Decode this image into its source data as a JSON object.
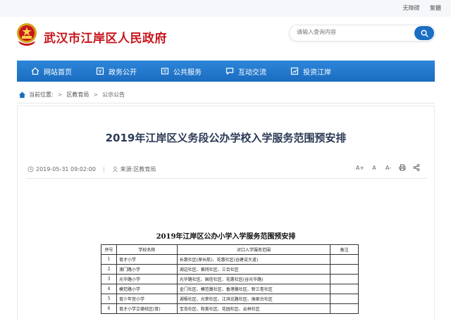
{
  "topbar": {
    "accessibility": "无障碍",
    "traditional": "繁體"
  },
  "header": {
    "site_title": "武汉市江岸区人民政府"
  },
  "search": {
    "placeholder": "请输入查询内容"
  },
  "nav": [
    {
      "label": "网站首页",
      "icon": "home-icon"
    },
    {
      "label": "政务公开",
      "icon": "document-icon"
    },
    {
      "label": "公共服务",
      "icon": "service-icon"
    },
    {
      "label": "互动交流",
      "icon": "chat-icon"
    },
    {
      "label": "投资江岸",
      "icon": "invest-icon"
    }
  ],
  "breadcrumb": {
    "prefix": "当前位置:",
    "items": [
      "区教育局",
      "公示公告"
    ],
    "separator": ">"
  },
  "article": {
    "title": "2019年江岸区义务段公办学校入学服务范围预安排",
    "datetime": "2019-05-31 09:02:00",
    "source": "来源:区教育局",
    "tools": [
      "A+",
      "A",
      "A-"
    ]
  },
  "document": {
    "title": "2019年江岸区公办小学入学服务范围预安排",
    "headers": [
      "序号",
      "学校名称",
      "对口入学服务范围",
      "备注"
    ],
    "rows": [
      [
        "1",
        "育才小学",
        "长惠社区(原长航)、花惠社区(谷建设大道)",
        ""
      ],
      [
        "2",
        "澳门路小学",
        "湖边社区、黄冈社区、三合社区",
        ""
      ],
      [
        "3",
        "光华路小学",
        "光华路社区、国信社区、花惠社区(谷光华路)",
        ""
      ],
      [
        "4",
        "模范路小学",
        "金门社区、模范路社区、香港路社区、新三卷社区",
        ""
      ],
      [
        "5",
        "育少年宫小学",
        "湖梧社区、光荣社区、江滨北路社区、振家台社区",
        ""
      ],
      [
        "6",
        "育才小学立德校区(育)",
        "宝岛社区、和美社区、花园社区、云林社区",
        ""
      ]
    ]
  },
  "colors": {
    "brand_red": "#c8161d",
    "nav_blue": "#1b6cc0",
    "title_navy": "#2b3a55"
  }
}
